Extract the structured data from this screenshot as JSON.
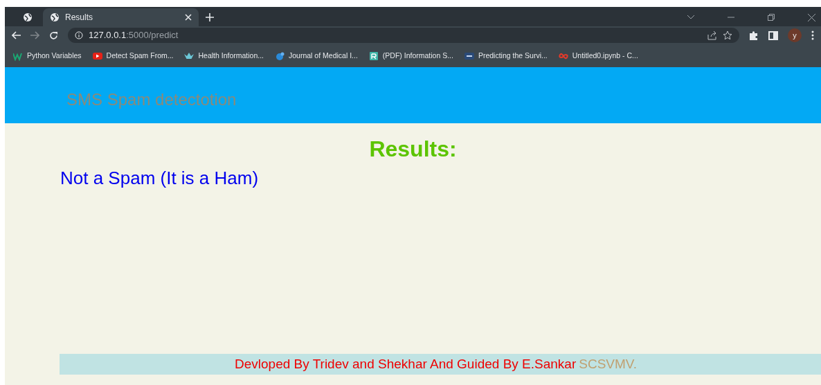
{
  "browser": {
    "tabs": [
      {
        "selected": false
      },
      {
        "title": "Results",
        "selected": true
      }
    ],
    "address": {
      "host": "127.0.0.1",
      "path": ":5000/predict"
    },
    "bookmarks": [
      {
        "label": "Python Variables",
        "kind": "w"
      },
      {
        "label": "Detect Spam From...",
        "kind": "video"
      },
      {
        "label": "Health Information...",
        "kind": "crown"
      },
      {
        "label": "Journal of Medical I...",
        "kind": "bird"
      },
      {
        "label": "(PDF) Information S...",
        "kind": "square"
      },
      {
        "label": "Predicting the Survi...",
        "kind": "tds"
      },
      {
        "label": "Untitled0.ipynb - C...",
        "kind": "colab"
      }
    ],
    "avatar": "y"
  },
  "page": {
    "header": "SMS Spam detectotion",
    "heading": "Results:",
    "result": "Not a Spam (It is a Ham)",
    "footer": {
      "text": "Devloped By Tridev and Shekhar And Guided By E.Sankar",
      "highlight": "SCSVMV."
    }
  }
}
